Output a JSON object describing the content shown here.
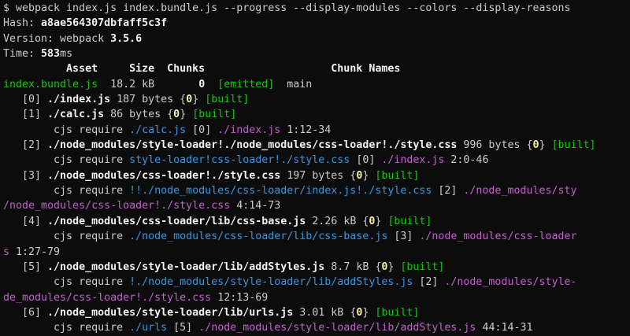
{
  "terminal": {
    "colors": {
      "background": "#0c0c0c",
      "default": "#cccccc",
      "bold": "#f2f2f2",
      "green": "#16c60c",
      "yellow": "#f9f1a5",
      "cyan": "#3a96dd",
      "magenta": "#c061cb"
    },
    "lines": [
      [
        {
          "t": "$ webpack index.js index.bundle.js --progress --display-modules --colors --display-reasons",
          "c": ""
        }
      ],
      [
        {
          "t": "Hash: ",
          "c": ""
        },
        {
          "t": "a8ae564307dbfaff5c3f",
          "c": "b"
        }
      ],
      [
        {
          "t": "Version: webpack ",
          "c": ""
        },
        {
          "t": "3.5.6",
          "c": "b"
        }
      ],
      [
        {
          "t": "Time: ",
          "c": ""
        },
        {
          "t": "583",
          "c": "b"
        },
        {
          "t": "ms",
          "c": ""
        }
      ],
      [
        {
          "t": "          Asset     Size  Chunks                    Chunk Names",
          "c": "b"
        }
      ],
      [
        {
          "t": "index.bundle.js",
          "c": "g"
        },
        {
          "t": "  18.2 kB       ",
          "c": ""
        },
        {
          "t": "0",
          "c": "b"
        },
        {
          "t": "  ",
          "c": ""
        },
        {
          "t": "[emitted]",
          "c": "g"
        },
        {
          "t": "  main",
          "c": ""
        }
      ],
      [
        {
          "t": "   [0] ",
          "c": ""
        },
        {
          "t": "./index.js",
          "c": "b"
        },
        {
          "t": " 187 bytes {",
          "c": ""
        },
        {
          "t": "0",
          "c": "y"
        },
        {
          "t": "} ",
          "c": ""
        },
        {
          "t": "[built]",
          "c": "g"
        }
      ],
      [
        {
          "t": "   [1] ",
          "c": ""
        },
        {
          "t": "./calc.js",
          "c": "b"
        },
        {
          "t": " 86 bytes {",
          "c": ""
        },
        {
          "t": "0",
          "c": "y"
        },
        {
          "t": "} ",
          "c": ""
        },
        {
          "t": "[built]",
          "c": "g"
        }
      ],
      [
        {
          "t": "        cjs require ",
          "c": ""
        },
        {
          "t": "./calc.js",
          "c": "c"
        },
        {
          "t": " [0] ",
          "c": ""
        },
        {
          "t": "./index.js",
          "c": "mb"
        },
        {
          "t": " 1:12-34",
          "c": ""
        }
      ],
      [
        {
          "t": "   [2] ",
          "c": ""
        },
        {
          "t": "./node_modules/style-loader!./node_modules/css-loader!./style.css",
          "c": "b"
        },
        {
          "t": " 996 bytes {",
          "c": ""
        },
        {
          "t": "0",
          "c": "y"
        },
        {
          "t": "} ",
          "c": ""
        },
        {
          "t": "[built]",
          "c": "g"
        }
      ],
      [
        {
          "t": "        cjs require ",
          "c": ""
        },
        {
          "t": "style-loader!css-loader!./style.css",
          "c": "c"
        },
        {
          "t": " [0] ",
          "c": ""
        },
        {
          "t": "./index.js",
          "c": "mb"
        },
        {
          "t": " 2:0-46",
          "c": ""
        }
      ],
      [
        {
          "t": "   [3] ",
          "c": ""
        },
        {
          "t": "./node_modules/css-loader!./style.css",
          "c": "b"
        },
        {
          "t": " 197 bytes {",
          "c": ""
        },
        {
          "t": "0",
          "c": "y"
        },
        {
          "t": "} ",
          "c": ""
        },
        {
          "t": "[built]",
          "c": "g"
        }
      ],
      [
        {
          "t": "        cjs require ",
          "c": ""
        },
        {
          "t": "!!./node_modules/css-loader/index.js!./style.css",
          "c": "c"
        },
        {
          "t": " [2] ",
          "c": ""
        },
        {
          "t": "./node_modules/sty",
          "c": "mb"
        }
      ],
      [
        {
          "t": "/node_modules/css-loader!./style.css",
          "c": "mb"
        },
        {
          "t": " 4:14-73",
          "c": ""
        }
      ],
      [
        {
          "t": "   [4] ",
          "c": ""
        },
        {
          "t": "./node_modules/css-loader/lib/css-base.js",
          "c": "b"
        },
        {
          "t": " 2.26 kB {",
          "c": ""
        },
        {
          "t": "0",
          "c": "y"
        },
        {
          "t": "} ",
          "c": ""
        },
        {
          "t": "[built]",
          "c": "g"
        }
      ],
      [
        {
          "t": "        cjs require ",
          "c": ""
        },
        {
          "t": "./node_modules/css-loader/lib/css-base.js",
          "c": "c"
        },
        {
          "t": " [3] ",
          "c": ""
        },
        {
          "t": "./node_modules/css-loader",
          "c": "mb"
        }
      ],
      [
        {
          "t": "s",
          "c": "mb"
        },
        {
          "t": " 1:27-79",
          "c": ""
        }
      ],
      [
        {
          "t": "   [5] ",
          "c": ""
        },
        {
          "t": "./node_modules/style-loader/lib/addStyles.js",
          "c": "b"
        },
        {
          "t": " 8.7 kB {",
          "c": ""
        },
        {
          "t": "0",
          "c": "y"
        },
        {
          "t": "} ",
          "c": ""
        },
        {
          "t": "[built]",
          "c": "g"
        }
      ],
      [
        {
          "t": "        cjs require ",
          "c": ""
        },
        {
          "t": "!./node_modules/style-loader/lib/addStyles.js",
          "c": "c"
        },
        {
          "t": " [2] ",
          "c": ""
        },
        {
          "t": "./node_modules/style-",
          "c": "mb"
        }
      ],
      [
        {
          "t": "de_modules/css-loader!./style.css",
          "c": "mb"
        },
        {
          "t": " 12:13-69",
          "c": ""
        }
      ],
      [
        {
          "t": "   [6] ",
          "c": ""
        },
        {
          "t": "./node_modules/style-loader/lib/urls.js",
          "c": "b"
        },
        {
          "t": " 3.01 kB {",
          "c": ""
        },
        {
          "t": "0",
          "c": "y"
        },
        {
          "t": "} ",
          "c": ""
        },
        {
          "t": "[built]",
          "c": "g"
        }
      ],
      [
        {
          "t": "        cjs require ",
          "c": ""
        },
        {
          "t": "./urls",
          "c": "c"
        },
        {
          "t": " [5] ",
          "c": ""
        },
        {
          "t": "./node_modules/style-loader/lib/addStyles.js",
          "c": "mb"
        },
        {
          "t": " 44:14-31",
          "c": ""
        }
      ]
    ]
  }
}
